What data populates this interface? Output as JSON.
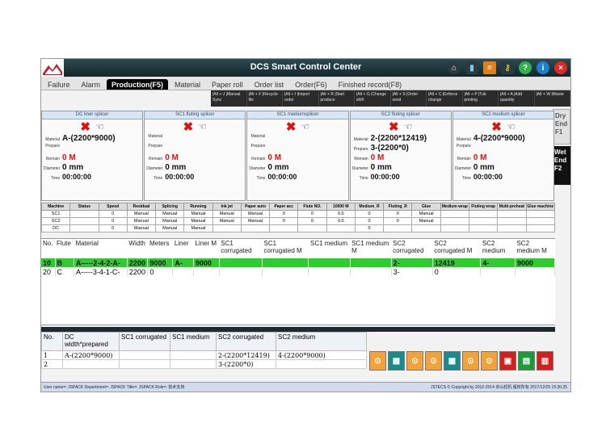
{
  "app": {
    "title": "DCS Smart Control Center"
  },
  "tabs": [
    "Failure",
    "Alarm",
    "Production(F5)",
    "Material",
    "Paper roll",
    "Order list",
    "Order(F6)",
    "Finished record(F8)"
  ],
  "active_tab": "Production(F5)",
  "shortcuts": [
    "|Alt + J |Manual Sync",
    "|Alt + F |Recycle file",
    "|Alt + I |Import order",
    "|Alt + R |Start produce",
    "|Alt + G |Change shift",
    "|Alt + S |Order send",
    "|Alt + C |Enforce change",
    "|Alt + P |Tub printing",
    "|Alt + A |Add quantity",
    "|Alt + W |Waste"
  ],
  "side_tabs": {
    "dry": "Dry End F1",
    "wet": "Wet End F2"
  },
  "splicer_labels": {
    "material": "Material",
    "prepare": "Prepare",
    "remain": "Remain",
    "diameter": "Diameter",
    "time": "Time"
  },
  "splicers": [
    {
      "title": "DC liner splicer",
      "material": "A-(2200*9000)",
      "prepare": "",
      "remain": "0 M",
      "diameter": "0 mm",
      "time": "00:00:00"
    },
    {
      "title": "SC1 fluting splicer",
      "material": "",
      "prepare": "",
      "remain": "0 M",
      "diameter": "0 mm",
      "time": "00:00:00"
    },
    {
      "title": "SC1 mediumsplicer",
      "material": "",
      "prepare": "",
      "remain": "0 M",
      "diameter": "0 mm",
      "time": "00:00:00"
    },
    {
      "title": "SC2 fluting splicer",
      "material": "2-(2200*12419)",
      "prepare": "3-(2200*0)",
      "remain": "0 M",
      "diameter": "0 mm",
      "time": "00:00:00"
    },
    {
      "title": "SC2 medium splicer",
      "material": "4-(2200*9000)",
      "prepare": "",
      "remain": "0 M",
      "diameter": "0 mm",
      "time": "00:00:00"
    }
  ],
  "status_table": {
    "headers": [
      "Machine",
      "Status",
      "Speed",
      "Residual",
      "Splicing",
      "Running",
      "Ink jet",
      "Paper auto",
      "Paper acc",
      "Flute NO.",
      "10000 M",
      "Medium_R",
      "Fluting_R",
      "Glue",
      "Medium wrap",
      "Fluting wrap",
      "Multi-preheat",
      "Glue machine"
    ],
    "rows": [
      [
        "SC1",
        "",
        "0",
        "Manual",
        "Manual",
        "Manual",
        "Manual",
        "Manual",
        "0",
        "0",
        "0.0",
        "0",
        "0",
        "Manual",
        "",
        "",
        "",
        ""
      ],
      [
        "SC2",
        "",
        "0",
        "Manual",
        "Manual",
        "Manual",
        "Manual",
        "Manual",
        "0",
        "0",
        "0.0",
        "0",
        "0",
        "Manual",
        "",
        "",
        "",
        ""
      ],
      [
        "DC",
        "",
        "0",
        "Manual",
        "Manual",
        "Manual",
        "",
        "",
        "",
        "",
        "",
        "0",
        "",
        "",
        "",
        "",
        "",
        ""
      ]
    ]
  },
  "order_table": {
    "headers": [
      "No.",
      "Flute",
      "Material",
      "Width",
      "Meters",
      "Liner",
      "Liner M",
      "SC1 corrugated",
      "SC1 corrugated M",
      "SC1 medium",
      "SC1 medium M",
      "SC2 corrugated",
      "SC2 corrugated M",
      "SC2 medium",
      "SC2 medium M"
    ],
    "rows": [
      [
        "10",
        "B",
        "A-----2-4-2-A-",
        "2200",
        "9000",
        "A-",
        "9000",
        "",
        "",
        "",
        "",
        "2-",
        "12419",
        "4-",
        "9000"
      ],
      [
        "20",
        "C",
        "A-----3-4-1-C-",
        "2200",
        "0",
        "",
        "",
        "",
        "",
        "",
        "",
        "3-",
        "0",
        "",
        ""
      ]
    ],
    "selected_row": 0
  },
  "prepared_table": {
    "headers": [
      "No.",
      "DC width*prepared",
      "SC1 corrugated",
      "SC1 medium",
      "SC2 corrugated",
      "SC2 medium"
    ],
    "rows": [
      [
        "1",
        "A-(2200*9000)",
        "",
        "",
        "2-(2200*12419)",
        "4-(2200*9000)"
      ],
      [
        "2",
        "",
        "",
        "",
        "3-(2200*0)",
        ""
      ]
    ]
  },
  "machine_icons": [
    {
      "name": "unwinder-icon",
      "color": "orange",
      "glyph": "⊙"
    },
    {
      "name": "single-facer-icon",
      "color": "teal",
      "glyph": "▦"
    },
    {
      "name": "unwinder-icon",
      "color": "orange",
      "glyph": "⊙"
    },
    {
      "name": "unwinder-icon",
      "color": "orange",
      "glyph": "⊙"
    },
    {
      "name": "single-facer-icon",
      "color": "teal",
      "glyph": "▦"
    },
    {
      "name": "unwinder-icon",
      "color": "orange",
      "glyph": "⊙"
    },
    {
      "name": "unwinder-icon",
      "color": "orange",
      "glyph": "⊙"
    },
    {
      "name": "preheater-icon",
      "color": "red",
      "glyph": "▣"
    },
    {
      "name": "glue-machine-icon",
      "color": "green",
      "glyph": "▤"
    },
    {
      "name": "double-backer-icon",
      "color": "red",
      "glyph": "▥"
    }
  ],
  "statusbar": {
    "left": "User name=: JSPACK   Department=: JSPACK   Title=: JSPACK   Role=: 技术支持",
    "right": "JSTECS © Copyright by 2012-2014 京山轻机 版权所有   2017/12/25 15:30:25"
  }
}
